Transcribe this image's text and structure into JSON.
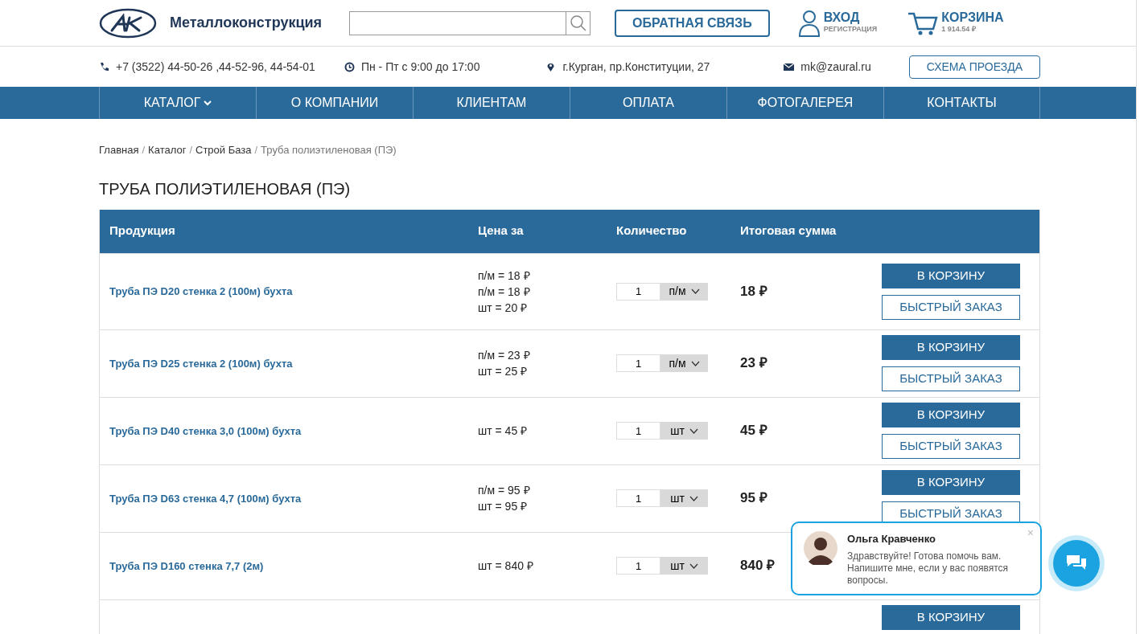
{
  "header": {
    "brand": "Металлоконструкция",
    "feedback_button": "ОБРАТНАЯ СВЯЗЬ",
    "login": {
      "title": "ВХОД",
      "subtitle": "РЕГИСТРАЦИЯ"
    },
    "cart": {
      "title": "КОРЗИНА",
      "total": "1 914.54 ₽"
    }
  },
  "info_bar": [
    {
      "kind": "phone",
      "text": "+7 (3522) 44-50-26 ,44-52-96, 44-54-01"
    },
    {
      "kind": "clock",
      "text": "Пн - Пт с 9:00 до 17:00"
    },
    {
      "kind": "pin",
      "text": "г.Курган, пр.Конституции, 27"
    },
    {
      "kind": "mail",
      "text": "mk@zaural.ru"
    }
  ],
  "route_button": "СХЕМА ПРОЕЗДА",
  "nav": [
    {
      "label": "КАТАЛОГ",
      "dropdown": true
    },
    {
      "label": "О КОМПАНИИ",
      "dropdown": false
    },
    {
      "label": "КЛИЕНТАМ",
      "dropdown": false
    },
    {
      "label": "ОПЛАТА",
      "dropdown": false
    },
    {
      "label": "ФОТОГАЛЕРЕЯ",
      "dropdown": false
    },
    {
      "label": "КОНТАКТЫ",
      "dropdown": false
    }
  ],
  "breadcrumbs": [
    {
      "label": "Главная",
      "current": false
    },
    {
      "separator": "/",
      "label": "Каталог",
      "current": false
    },
    {
      "separator": "/",
      "label": "Строй База",
      "current": false
    },
    {
      "separator": "/",
      "label": "Труба полиэтиленовая (ПЭ)",
      "current": true
    }
  ],
  "page_title": "ТРУБА ПОЛИЭТИЛЕНОВАЯ (ПЭ)",
  "table": {
    "columns": [
      "Продукция",
      "Цена за",
      "Количество",
      "Итоговая сумма"
    ],
    "rows": [
      {
        "name": "Труба ПЭ D20 стенка 2 (100м) бухта",
        "prices": [
          "п/м = 18 ₽",
          "п/м = 18 ₽",
          "шт = 20 ₽"
        ],
        "qty": "1",
        "unit": "п/м",
        "total": "18 ₽",
        "cart_button": "В КОРЗИНУ",
        "quick_order": "БЫСТРЫЙ ЗАКАЗ"
      },
      {
        "name": "Труба ПЭ D25 стенка 2 (100м) бухта",
        "prices": [
          "п/м = 23 ₽",
          "шт = 25 ₽"
        ],
        "qty": "1",
        "unit": "п/м",
        "total": "23 ₽",
        "cart_button": "В КОРЗИНУ",
        "quick_order": "БЫСТРЫЙ ЗАКАЗ"
      },
      {
        "name": "Труба ПЭ D40 стенка 3,0 (100м) бухта",
        "prices": [
          "шт = 45 ₽"
        ],
        "qty": "1",
        "unit": "шт",
        "total": "45 ₽",
        "cart_button": "В КОРЗИНУ",
        "quick_order": "БЫСТРЫЙ ЗАКАЗ"
      },
      {
        "name": "Труба ПЭ D63 стенка 4,7 (100м) бухта",
        "prices": [
          "п/м = 95 ₽",
          "шт = 95 ₽"
        ],
        "qty": "1",
        "unit": "шт",
        "total": "95 ₽",
        "cart_button": "В КОРЗИНУ",
        "quick_order": "БЫСТРЫЙ ЗАКАЗ"
      },
      {
        "name": "Труба ПЭ D160 стенка 7,7 (2м)",
        "prices": [
          "шт = 840 ₽"
        ],
        "qty": "1",
        "unit": "шт",
        "total": "840 ₽"
      },
      {
        "cart_button": "В КОРЗИНУ"
      }
    ]
  },
  "chat": {
    "name": "Ольга Кравченко",
    "message": "Здравствуйте! Готова помочь вам. Напишите мне, если у вас появятся вопросы.",
    "close": "×"
  }
}
